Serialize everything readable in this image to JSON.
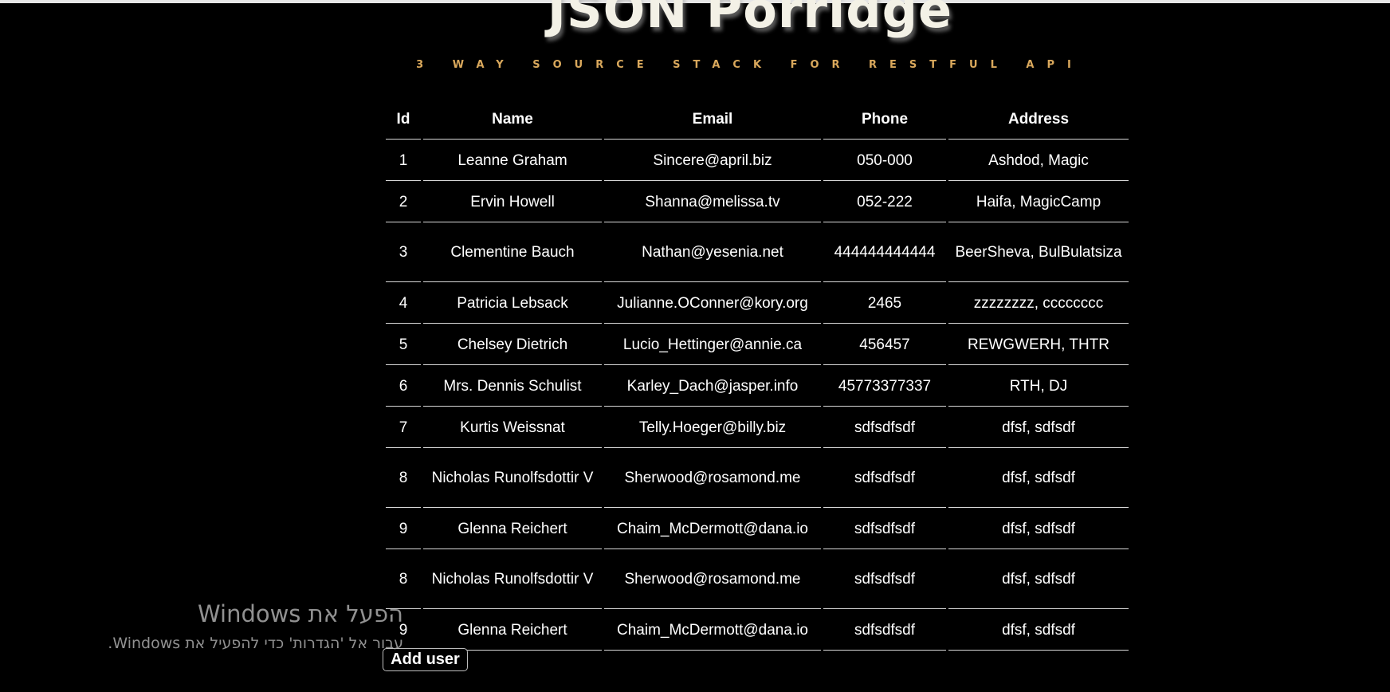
{
  "header": {
    "title": "JSON Porridge",
    "subtitle": "3 WAY SOURCE STACK FOR RESTFUL API"
  },
  "table": {
    "columns": [
      "Id",
      "Name",
      "Email",
      "Phone",
      "Address"
    ],
    "rows": [
      [
        "1",
        "Leanne Graham",
        "Sincere@april.biz",
        "050-000",
        "Ashdod, Magic"
      ],
      [
        "2",
        "Ervin Howell",
        "Shanna@melissa.tv",
        "052-222",
        "Haifa, MagicCamp"
      ],
      [
        "3",
        "Clementine Bauch",
        "Nathan@yesenia.net",
        "444444444444",
        "BeerSheva, BulBulatsiza"
      ],
      [
        "4",
        "Patricia Lebsack",
        "Julianne.OConner@kory.org",
        "2465",
        "zzzzzzzz, cccccccc"
      ],
      [
        "5",
        "Chelsey Dietrich",
        "Lucio_Hettinger@annie.ca",
        "456457",
        "REWGWERH, THTR"
      ],
      [
        "6",
        "Mrs. Dennis Schulist",
        "Karley_Dach@jasper.info",
        "45773377337",
        "RTH, DJ"
      ],
      [
        "7",
        "Kurtis Weissnat",
        "Telly.Hoeger@billy.biz",
        "sdfsdfsdf",
        "dfsf, sdfsdf"
      ],
      [
        "8",
        "Nicholas Runolfsdottir V",
        "Sherwood@rosamond.me",
        "sdfsdfsdf",
        "dfsf, sdfsdf"
      ],
      [
        "9",
        "Glenna Reichert",
        "Chaim_McDermott@dana.io",
        "sdfsdfsdf",
        "dfsf, sdfsdf"
      ],
      [
        "8",
        "Nicholas Runolfsdottir V",
        "Sherwood@rosamond.me",
        "sdfsdfsdf",
        "dfsf, sdfsdf"
      ],
      [
        "9",
        "Glenna Reichert",
        "Chaim_McDermott@dana.io",
        "sdfsdfsdf",
        "dfsf, sdfsdf"
      ]
    ],
    "double_rows": [
      2,
      7,
      9
    ]
  },
  "actions": {
    "add_user_label": "Add user"
  },
  "watermark": {
    "line1": "הפעל את Windows",
    "line2": "עבור אל 'הגדרות' כדי להפעיל את Windows."
  }
}
